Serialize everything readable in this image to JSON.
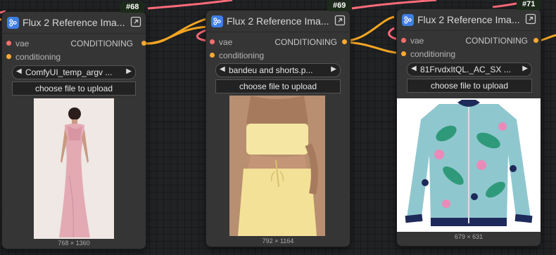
{
  "colors": {
    "vae_slot": "#ff6e6e",
    "conditioning_slot": "#ffa931",
    "node_bg": "#353535",
    "node_icon": "#3f7ee6",
    "wire_conditioning": "#f5a623",
    "wire_vae": "#ff6b7a"
  },
  "nodes": [
    {
      "badge": "#68",
      "title": "Flux 2 Reference Ima...",
      "input_vae": "vae",
      "input_conditioning": "conditioning",
      "output": "CONDITIONING",
      "image_value": "ComfyUI_temp_argv ...",
      "upload_label": "choose file to upload",
      "image_size": "768 × 1360",
      "preview_desc": "woman in pink sequin gown",
      "output_visible": true
    },
    {
      "badge": "#69",
      "title": "Flux 2 Reference Ima...",
      "input_vae": "vae",
      "input_conditioning": "conditioning",
      "output": "CONDITIONING",
      "image_value": "bandeu and shorts.p...",
      "upload_label": "choose file to upload",
      "image_size": "792 × 1164",
      "preview_desc": "yellow bandeau top and shorts"
    },
    {
      "badge": "#71",
      "title": "Flux 2 Reference Ima...",
      "input_vae": "vae",
      "input_conditioning": "conditioning",
      "output": "CONDITIONING",
      "image_value": "81FrvdxItQL._AC_SX ...",
      "upload_label": "choose file to upload",
      "image_size": "679 × 631",
      "preview_desc": "tropical print bomber jacket"
    }
  ]
}
